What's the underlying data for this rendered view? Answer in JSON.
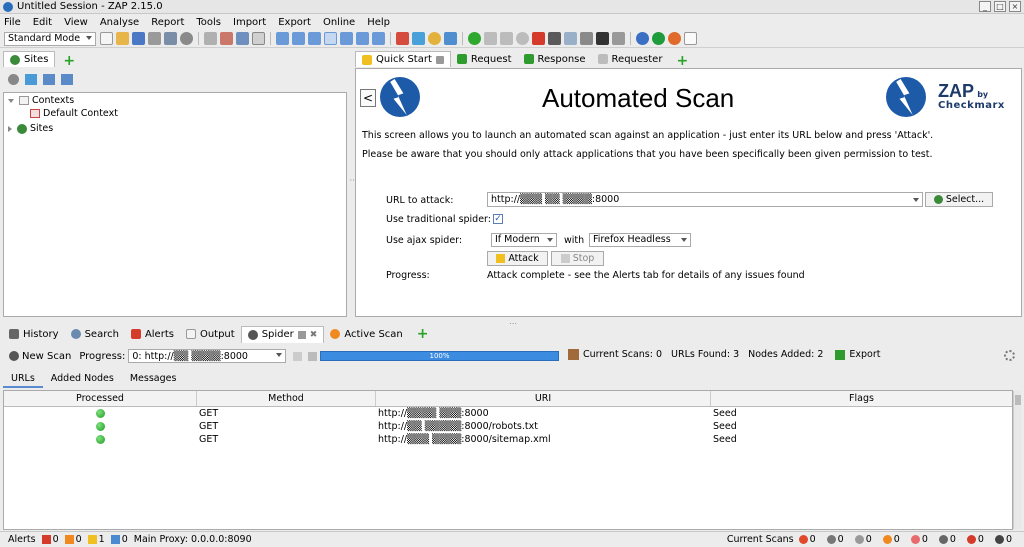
{
  "window": {
    "title": "Untitled Session - ZAP 2.15.0",
    "controls": [
      "_",
      "□",
      "×"
    ]
  },
  "menu": [
    "File",
    "Edit",
    "View",
    "Analyse",
    "Report",
    "Tools",
    "Import",
    "Export",
    "Online",
    "Help"
  ],
  "toolbar": {
    "mode": "Standard Mode"
  },
  "sites_panel": {
    "tab_label": "Sites",
    "tree": [
      {
        "label": "Contexts"
      },
      {
        "label": "Default Context"
      },
      {
        "label": "Sites"
      }
    ]
  },
  "top_tabs": [
    {
      "label": "Quick Start"
    },
    {
      "label": "Request"
    },
    {
      "label": "Response"
    },
    {
      "label": "Requester"
    }
  ],
  "quick_start": {
    "back": "<",
    "title": "Automated Scan",
    "brand": {
      "zap": "ZAP",
      "by": "by",
      "company": "Checkmarx"
    },
    "intro": "This screen allows you to launch an automated scan against  an application - just enter its URL below and press 'Attack'.",
    "warning": "Please be aware that you should only attack applications that you have been specifically been given permission to test.",
    "url_label": "URL to attack:",
    "url_value": "http://▒▒▒ ▒▒ ▒▒▒▒:8000",
    "select_button": "Select...",
    "spider_label": "Use traditional spider:",
    "spider_checked": "✓",
    "ajax_label": "Use ajax spider:",
    "ajax_mode": "If Modern",
    "with_label": "with",
    "browser": "Firefox Headless",
    "attack_button": "Attack",
    "stop_button": "Stop",
    "progress_label": "Progress:",
    "progress_text": "Attack complete - see the Alerts tab for details of any issues found"
  },
  "bottom_tabs": [
    {
      "label": "History"
    },
    {
      "label": "Search"
    },
    {
      "label": "Alerts"
    },
    {
      "label": "Output"
    },
    {
      "label": "Spider"
    },
    {
      "label": "Active Scan"
    }
  ],
  "spider": {
    "new_scan": "New Scan",
    "progress_label": "Progress:",
    "progress_select": "0: http://▒▒ ▒▒▒▒:8000",
    "progress_percent": "100%",
    "progress_fraction": 1.0,
    "current_scans": "Current Scans: 0",
    "urls_found": "URLs Found: 3",
    "nodes_added": "Nodes Added: 2",
    "export": "Export",
    "subtabs": [
      "URLs",
      "Added Nodes",
      "Messages"
    ],
    "columns": [
      "Processed",
      "Method",
      "URI",
      "Flags"
    ],
    "rows": [
      {
        "method": "GET",
        "uri": "http://▒▒▒▒ ▒▒▒:8000",
        "flags": "Seed"
      },
      {
        "method": "GET",
        "uri": "http://▒▒ ▒▒▒▒▒:8000/robots.txt",
        "flags": "Seed"
      },
      {
        "method": "GET",
        "uri": "http://▒▒▒ ▒▒▒▒:8000/sitemap.xml",
        "flags": "Seed"
      }
    ]
  },
  "status": {
    "alerts_label": "Alerts",
    "alert_counts": [
      "0",
      "0",
      "1",
      "0"
    ],
    "proxy": "Main Proxy: 0.0.0.0:8090",
    "current_scans_label": "Current Scans",
    "scan_counts": [
      "0",
      "0",
      "0",
      "0",
      "0",
      "0",
      "0",
      "0"
    ]
  }
}
